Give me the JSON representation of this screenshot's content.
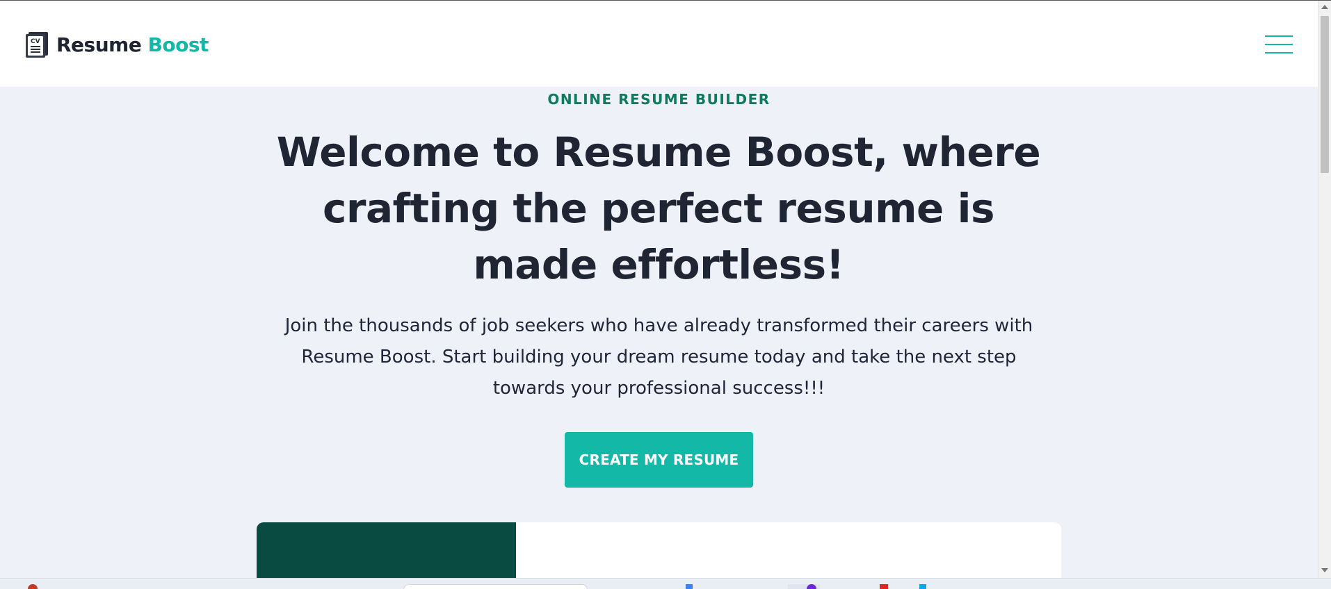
{
  "header": {
    "brand_name": "Resume",
    "brand_accent": "Boost",
    "icon_text": "CV",
    "menu_icon": "hamburger-menu-icon"
  },
  "hero": {
    "eyebrow": "ONLINE RESUME BUILDER",
    "headline": "Welcome to Resume Boost, where crafting the perfect resume is made effortless!",
    "subcopy": "Join the thousands of job seekers who have already transformed their careers with Resume Boost. Start building your dream resume today and take the next step towards your professional success!!!",
    "cta_label": "CREATE MY RESUME"
  },
  "colors": {
    "accent": "#14b8a6",
    "eyebrow": "#0e7a5f",
    "text": "#1f2533",
    "background": "#eef1f8",
    "card_dark": "#0a4b41"
  }
}
